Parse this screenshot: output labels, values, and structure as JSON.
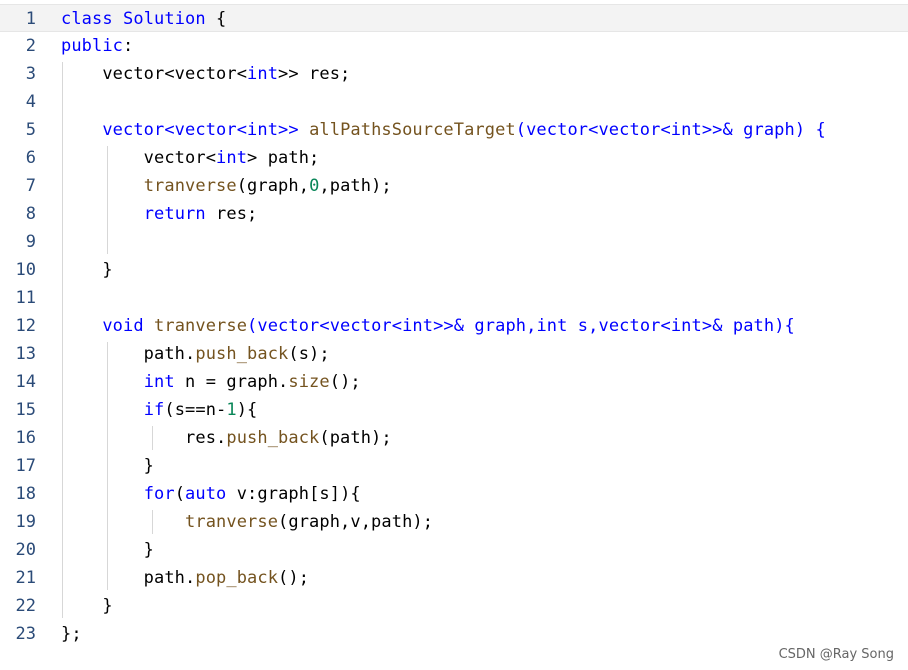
{
  "colors": {
    "keyword": "#0000ff",
    "type": "#0000ff",
    "function": "#74531f",
    "plain": "#000000",
    "number": "#098658",
    "line_number": "#2b4b78",
    "current_line_bg": "#f3f3f3"
  },
  "lines": [
    {
      "n": "1",
      "tokens": [
        {
          "t": "class",
          "c": "keyword"
        },
        {
          "t": " "
        },
        {
          "t": "Solution",
          "c": "type"
        },
        {
          "t": " {"
        }
      ]
    },
    {
      "n": "2",
      "tokens": [
        {
          "t": "public",
          "c": "keyword"
        },
        {
          "t": ":"
        }
      ]
    },
    {
      "n": "3",
      "tokens": [
        {
          "t": "    vector<vector<",
          "c": "plain"
        },
        {
          "t": "int",
          "c": "keyword"
        },
        {
          "t": ">> res;"
        }
      ]
    },
    {
      "n": "4",
      "tokens": []
    },
    {
      "n": "5",
      "tokens": [
        {
          "t": "    vector<vector<",
          "c": "type"
        },
        {
          "t": "int",
          "c": "keyword"
        },
        {
          "t": ">> ",
          "c": "type"
        },
        {
          "t": "allPathsSourceTarget",
          "c": "function"
        },
        {
          "t": "(vector<vector<",
          "c": "type"
        },
        {
          "t": "int",
          "c": "keyword"
        },
        {
          "t": ">>& graph) {",
          "c": "type"
        }
      ]
    },
    {
      "n": "6",
      "tokens": [
        {
          "t": "        vector<"
        },
        {
          "t": "int",
          "c": "keyword"
        },
        {
          "t": "> path;"
        }
      ]
    },
    {
      "n": "7",
      "tokens": [
        {
          "t": "        "
        },
        {
          "t": "tranverse",
          "c": "function"
        },
        {
          "t": "(graph,"
        },
        {
          "t": "0",
          "c": "number"
        },
        {
          "t": ",path);"
        }
      ]
    },
    {
      "n": "8",
      "tokens": [
        {
          "t": "        "
        },
        {
          "t": "return",
          "c": "keyword"
        },
        {
          "t": " res;"
        }
      ]
    },
    {
      "n": "9",
      "tokens": []
    },
    {
      "n": "10",
      "tokens": [
        {
          "t": "    }"
        }
      ]
    },
    {
      "n": "11",
      "tokens": []
    },
    {
      "n": "12",
      "tokens": [
        {
          "t": "    "
        },
        {
          "t": "void",
          "c": "keyword"
        },
        {
          "t": " "
        },
        {
          "t": "tranverse",
          "c": "function"
        },
        {
          "t": "(vector<vector<",
          "c": "type"
        },
        {
          "t": "int",
          "c": "keyword"
        },
        {
          "t": ">>& graph,",
          "c": "type"
        },
        {
          "t": "int",
          "c": "keyword"
        },
        {
          "t": " s,",
          "c": "type"
        },
        {
          "t": "vector<",
          "c": "type"
        },
        {
          "t": "int",
          "c": "keyword"
        },
        {
          "t": ">& path){",
          "c": "type"
        }
      ]
    },
    {
      "n": "13",
      "tokens": [
        {
          "t": "        path."
        },
        {
          "t": "push_back",
          "c": "function"
        },
        {
          "t": "(s);"
        }
      ]
    },
    {
      "n": "14",
      "tokens": [
        {
          "t": "        "
        },
        {
          "t": "int",
          "c": "keyword"
        },
        {
          "t": " n = graph."
        },
        {
          "t": "size",
          "c": "function"
        },
        {
          "t": "();"
        }
      ]
    },
    {
      "n": "15",
      "tokens": [
        {
          "t": "        "
        },
        {
          "t": "if",
          "c": "keyword"
        },
        {
          "t": "(s==n-"
        },
        {
          "t": "1",
          "c": "number"
        },
        {
          "t": "){"
        }
      ]
    },
    {
      "n": "16",
      "tokens": [
        {
          "t": "            res."
        },
        {
          "t": "push_back",
          "c": "function"
        },
        {
          "t": "(path);"
        }
      ]
    },
    {
      "n": "17",
      "tokens": [
        {
          "t": "        }"
        }
      ]
    },
    {
      "n": "18",
      "tokens": [
        {
          "t": "        "
        },
        {
          "t": "for",
          "c": "keyword"
        },
        {
          "t": "("
        },
        {
          "t": "auto",
          "c": "keyword"
        },
        {
          "t": " v:graph[s]){"
        }
      ]
    },
    {
      "n": "19",
      "tokens": [
        {
          "t": "            "
        },
        {
          "t": "tranverse",
          "c": "function"
        },
        {
          "t": "(graph,v,path);"
        }
      ]
    },
    {
      "n": "20",
      "tokens": [
        {
          "t": "        }"
        }
      ]
    },
    {
      "n": "21",
      "tokens": [
        {
          "t": "        path."
        },
        {
          "t": "pop_back",
          "c": "function"
        },
        {
          "t": "();"
        }
      ]
    },
    {
      "n": "22",
      "tokens": [
        {
          "t": "    }"
        }
      ]
    },
    {
      "n": "23",
      "tokens": [
        {
          "t": "};"
        }
      ]
    }
  ],
  "watermark": "CSDN @Ray Song"
}
